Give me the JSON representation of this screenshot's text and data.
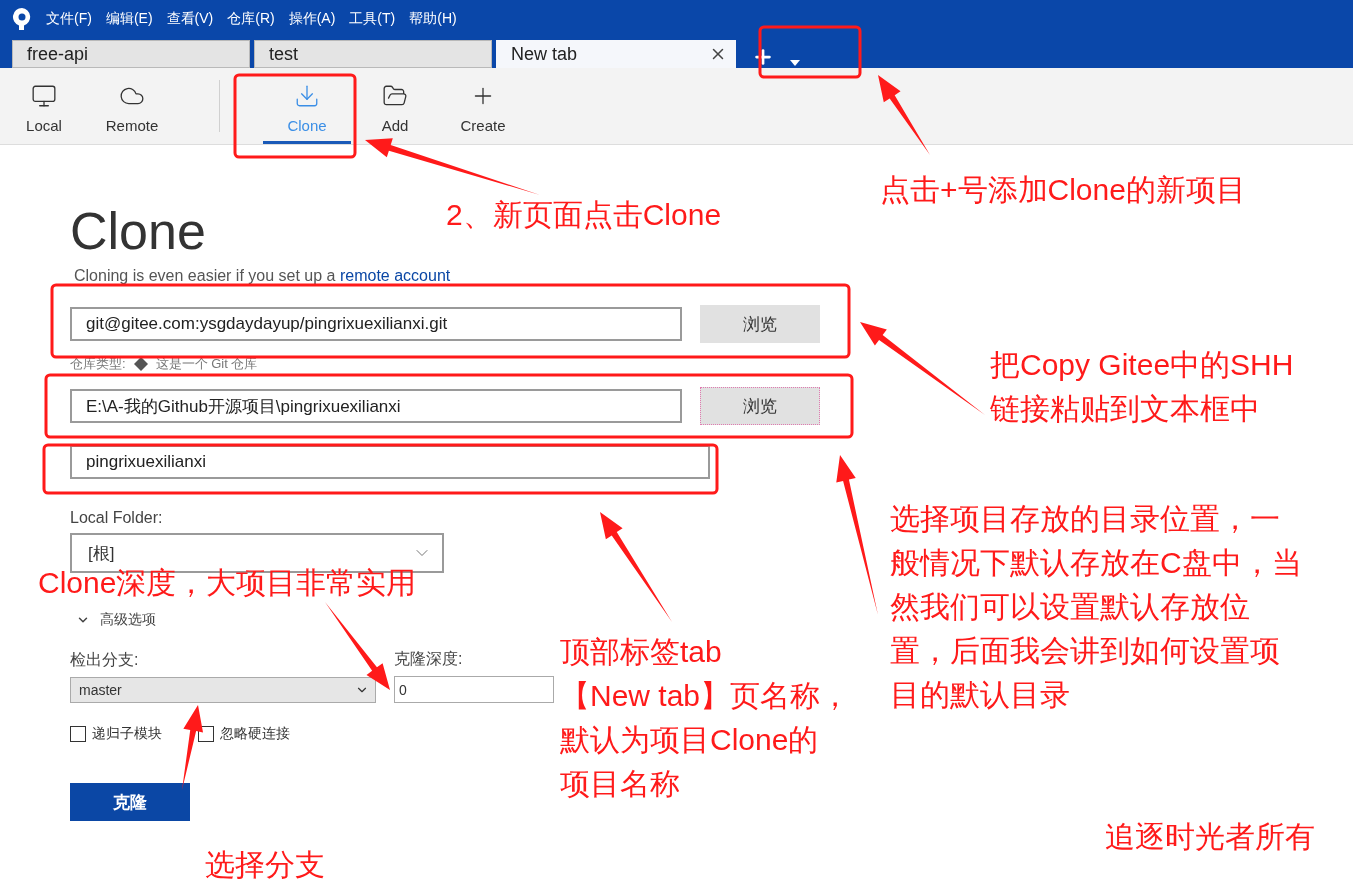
{
  "menu": [
    "文件(F)",
    "编辑(E)",
    "查看(V)",
    "仓库(R)",
    "操作(A)",
    "工具(T)",
    "帮助(H)"
  ],
  "tabs": [
    {
      "label": "free-api",
      "selected": false
    },
    {
      "label": "test",
      "selected": false
    },
    {
      "label": "New tab",
      "selected": true
    }
  ],
  "toolbar": [
    {
      "label": "Local",
      "kind": "monitor",
      "selected": false
    },
    {
      "label": "Remote",
      "kind": "cloud",
      "selected": false
    },
    {
      "label": "Clone",
      "kind": "download",
      "selected": true
    },
    {
      "label": "Add",
      "kind": "folder",
      "selected": false
    },
    {
      "label": "Create",
      "kind": "plus",
      "selected": false
    }
  ],
  "clone": {
    "title": "Clone",
    "hint": "Cloning is even easier if you set up a",
    "link": "remote account",
    "source_url": "git@gitee.com:ysgdaydayup/pingrixuexilianxi.git",
    "browse_source": "浏览",
    "repo_type_label": "仓库类型:",
    "repo_type": "这是一个 Git 仓库",
    "destination": "E:\\A-我的Github开源项目\\pingrixuexilianxi",
    "browse_destination": "浏览",
    "name": "pingrixuexilianxi",
    "local_folder_label": "Local Folder:",
    "local_folder": "[根]",
    "advanced": {
      "label": "高级选项",
      "expanded": true
    },
    "branch_label": "检出分支:",
    "branch": "master",
    "depth_label": "克隆深度:",
    "depth": "0",
    "checkboxes": [
      {
        "label": "递归子模块",
        "checked": false
      },
      {
        "label": "忽略硬连接",
        "checked": false
      }
    ],
    "submit": "克隆"
  },
  "annotations": [
    {
      "lines": [
        "2、新页面点击Clone"
      ]
    },
    {
      "lines": [
        "点击+号添加Clone的新项目"
      ]
    },
    {
      "lines": [
        "把Copy Gitee中的SHH",
        "链接粘贴到文本框中"
      ]
    },
    {
      "lines": [
        "选择项目存放的目录位置，一",
        "般情况下默认存放在C盘中，当",
        "然我们可以设置默认存放位",
        "置，后面我会讲到如何设置项",
        "目的默认目录"
      ]
    },
    {
      "lines": [
        "Clone深度，大项目非常实用"
      ]
    },
    {
      "lines": [
        "顶部标签tab",
        "【New tab】页名称，",
        "默认为项目Clone的",
        "项目名称"
      ]
    },
    {
      "lines": [
        "选择分支"
      ]
    },
    {
      "lines": [
        "追逐时光者所有"
      ]
    }
  ]
}
